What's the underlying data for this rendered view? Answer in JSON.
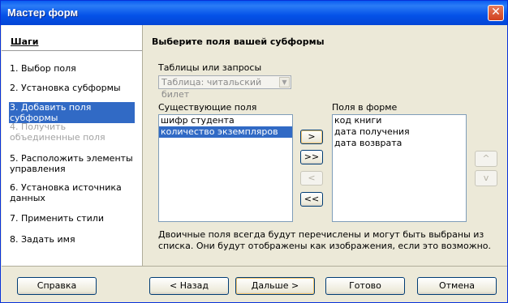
{
  "window": {
    "title": "Мастер форм",
    "close_label": "✕"
  },
  "sidebar": {
    "title": "Шаги",
    "steps": [
      {
        "label": "1. Выбор поля",
        "state": "normal"
      },
      {
        "label": "2. Установка субформы",
        "state": "normal"
      },
      {
        "label": "3. Добавить поля субформы",
        "state": "selected"
      },
      {
        "label": "4. Получить объединенные поля",
        "state": "disabled"
      },
      {
        "label": "5. Расположить элементы управления",
        "state": "normal"
      },
      {
        "label": "6. Установка источника данных",
        "state": "normal"
      },
      {
        "label": "7. Применить стили",
        "state": "normal"
      },
      {
        "label": "8. Задать имя",
        "state": "normal"
      }
    ]
  },
  "main": {
    "title": "Выберите поля вашей субформы",
    "tables_label": "Таблицы или запросы",
    "tables_value": "Таблица: читальский билет",
    "existing_label": "Существующие поля",
    "existing_fields": [
      "шифр студента",
      "количество экземпляров"
    ],
    "selected_existing": "количество экземпляров",
    "form_label": "Поля в форме",
    "form_fields": [
      "код книги",
      "дата получения",
      "дата возврата"
    ],
    "move_buttons": {
      "add_one": ">",
      "add_all": ">>",
      "remove_one": "<",
      "remove_all": "<<"
    },
    "order_buttons": {
      "up": "^",
      "down": "v"
    },
    "note": "Двоичные поля всегда будут перечислены и могут быть выбраны из списка. Они будут отображены как изображения, если это возможно."
  },
  "footer": {
    "help": "Справка",
    "back": "< Назад",
    "next": "Дальше >",
    "finish": "Готово",
    "cancel": "Отмена"
  },
  "colors": {
    "titlebar": "#0452e8",
    "selection": "#316ac5",
    "dialog_bg": "#ece9d8"
  }
}
